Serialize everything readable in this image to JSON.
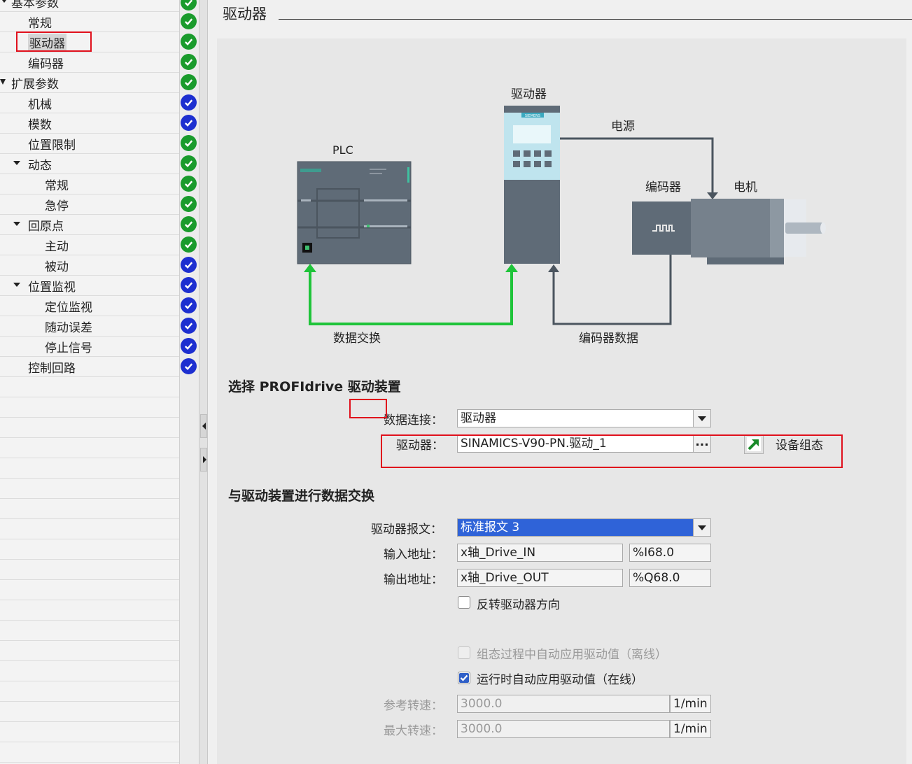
{
  "tree": {
    "items": [
      {
        "label": "基本参数",
        "status": "green"
      },
      {
        "label": "常规",
        "status": "green"
      },
      {
        "label": "驱动器",
        "status": "green"
      },
      {
        "label": "编码器",
        "status": "green"
      },
      {
        "label": "扩展参数",
        "status": "green"
      },
      {
        "label": "机械",
        "status": "blue"
      },
      {
        "label": "模数",
        "status": "blue"
      },
      {
        "label": "位置限制",
        "status": "green"
      },
      {
        "label": "动态",
        "status": "green"
      },
      {
        "label": "常规",
        "status": "green"
      },
      {
        "label": "急停",
        "status": "green"
      },
      {
        "label": "回原点",
        "status": "green"
      },
      {
        "label": "主动",
        "status": "green"
      },
      {
        "label": "被动",
        "status": "blue"
      },
      {
        "label": "位置监视",
        "status": "blue"
      },
      {
        "label": "定位监视",
        "status": "blue"
      },
      {
        "label": "随动误差",
        "status": "blue"
      },
      {
        "label": "停止信号",
        "status": "blue"
      },
      {
        "label": "控制回路",
        "status": "blue"
      }
    ]
  },
  "header": {
    "title": "驱动器"
  },
  "diagram": {
    "drive_label": "驱动器",
    "plc_label": "PLC",
    "power_label": "电源",
    "encoder_label": "编码器",
    "motor_label": "电机",
    "data_exchange_label": "数据交换",
    "encoder_data_label": "编码器数据",
    "drive_brand": "SIEMENS",
    "plc_brand": "SIEMENS"
  },
  "section1": {
    "title": "选择 PROFIdrive 驱动装置",
    "data_connection_label": "数据连接：",
    "data_connection_value": "驱动器",
    "drive_label": "驱动器：",
    "drive_value": "SINAMICS-V90-PN.驱动_1",
    "browse_label": "...",
    "device_config_label": "设备组态"
  },
  "section2": {
    "title": "与驱动装置进行数据交换",
    "telegram_label": "驱动器报文：",
    "telegram_value": "标准报文 3",
    "input_label": "输入地址：",
    "input_tag": "x轴_Drive_IN",
    "input_addr": "%I68.0",
    "output_label": "输出地址：",
    "output_tag": "x轴_Drive_OUT",
    "output_addr": "%Q68.0",
    "invert_label": "反转驱动器方向",
    "invert_checked": false,
    "auto_offline_label": "组态过程中自动应用驱动值（离线）",
    "auto_offline_checked": false,
    "auto_online_label": "运行时自动应用驱动值（在线）",
    "auto_online_checked": true,
    "ref_speed_label": "参考转速：",
    "ref_speed_value": "3000.0",
    "ref_speed_unit": "1/min",
    "max_speed_label": "最大转速：",
    "max_speed_value": "3000.0",
    "max_speed_unit": "1/min"
  }
}
